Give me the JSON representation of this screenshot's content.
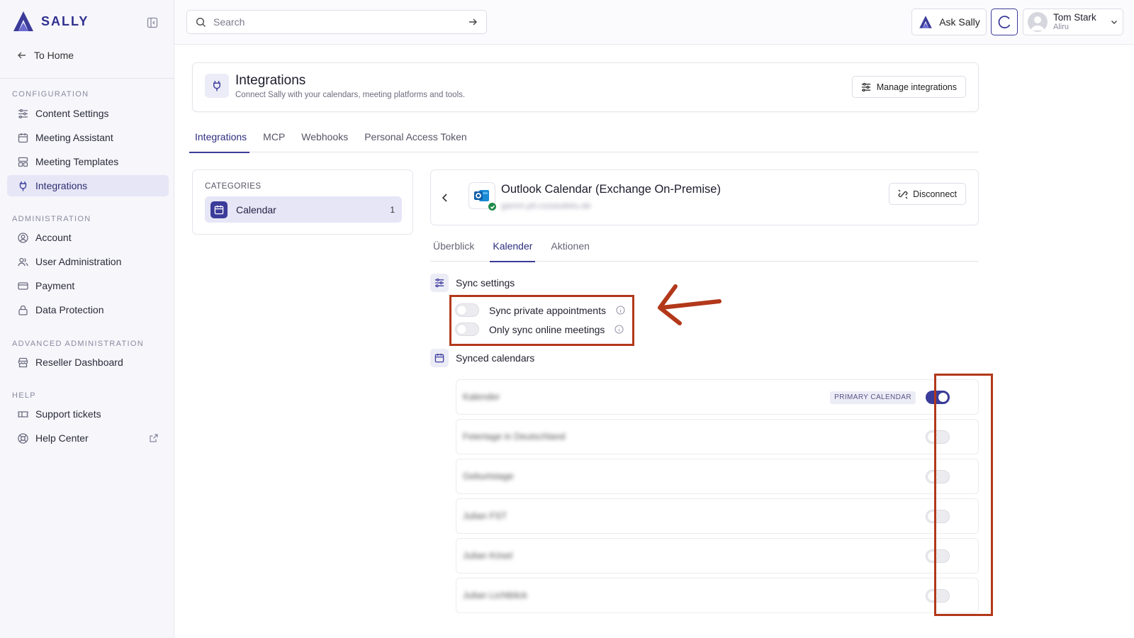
{
  "app": {
    "logo_text": "SALLY"
  },
  "sidebar": {
    "to_home": "To Home",
    "sections": {
      "configuration": "CONFIGURATION",
      "administration": "ADMINISTRATION",
      "advanced": "ADVANCED ADMINISTRATION",
      "help": "HELP"
    },
    "items": [
      {
        "label": "Content Settings",
        "icon": "sliders-icon"
      },
      {
        "label": "Meeting Assistant",
        "icon": "calendar-icon"
      },
      {
        "label": "Meeting Templates",
        "icon": "template-icon"
      },
      {
        "label": "Integrations",
        "icon": "plug-icon",
        "active": true
      },
      {
        "label": "Account",
        "icon": "user-circle-icon"
      },
      {
        "label": "User Administration",
        "icon": "users-icon"
      },
      {
        "label": "Payment",
        "icon": "credit-card-icon"
      },
      {
        "label": "Data Protection",
        "icon": "lock-icon"
      },
      {
        "label": "Reseller Dashboard",
        "icon": "store-icon"
      },
      {
        "label": "Support tickets",
        "icon": "ticket-icon"
      },
      {
        "label": "Help Center",
        "icon": "lifebuoy-icon"
      }
    ]
  },
  "topbar": {
    "search_placeholder": "Search",
    "ask_sally": "Ask Sally",
    "user_name": "Tom Stark",
    "user_org": "Aliru"
  },
  "integrations_header": {
    "title": "Integrations",
    "subtitle": "Connect Sally with your calendars, meeting platforms and tools.",
    "manage_button": "Manage integrations"
  },
  "tabs": [
    "Integrations",
    "MCP",
    "Webhooks",
    "Personal Access Token"
  ],
  "categories": {
    "label": "CATEGORIES",
    "items": [
      {
        "name": "Calendar",
        "count": "1"
      }
    ]
  },
  "integration_detail": {
    "title": "Outlook Calendar (Exchange On-Premise)",
    "email": "gamm.pit.cozasaletu.de",
    "disconnect_button": "Disconnect",
    "subtabs": [
      "Überblick",
      "Kalender",
      "Aktionen"
    ]
  },
  "sync_settings": {
    "title": "Sync settings",
    "options": [
      {
        "label": "Sync private appointments",
        "enabled": false
      },
      {
        "label": "Only sync online meetings",
        "enabled": false
      }
    ]
  },
  "synced_calendars": {
    "title": "Synced calendars",
    "primary_badge": "PRIMARY CALENDAR",
    "rows": [
      {
        "name": "Kalender",
        "enabled": true,
        "primary": true
      },
      {
        "name": "Feiertage in Deutschland",
        "enabled": false
      },
      {
        "name": "Geburtstage",
        "enabled": false
      },
      {
        "name": "Julian FST",
        "enabled": false
      },
      {
        "name": "Julian Kösel",
        "enabled": false
      },
      {
        "name": "Julian Lichtblick",
        "enabled": false
      }
    ]
  },
  "colors": {
    "accent": "#3b3b9a",
    "annotation": "#b2381a",
    "active_bg": "#e6e6f7"
  }
}
